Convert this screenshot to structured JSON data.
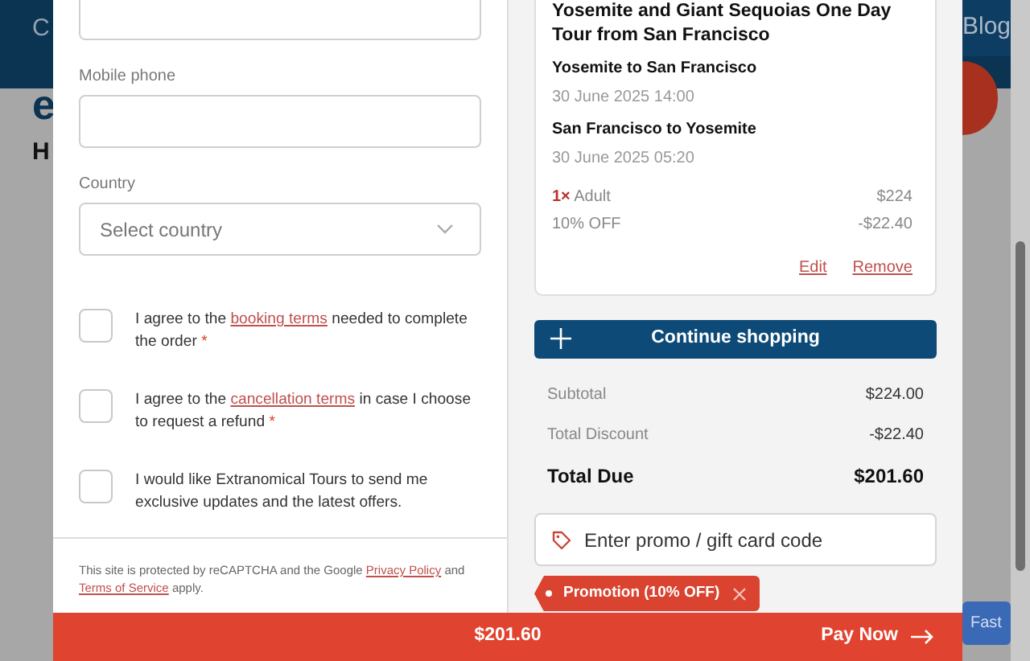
{
  "background": {
    "nav_left": "C",
    "nav_right": "Blog",
    "logo_letter": "e",
    "heading_letter": "H",
    "fast_button": "Fast"
  },
  "form": {
    "fields": [
      {
        "kind": "input"
      },
      {
        "kind": "input",
        "label": "Mobile phone"
      },
      {
        "kind": "select",
        "label": "Country",
        "placeholder": "Select country"
      }
    ],
    "consents": [
      {
        "before": "I agree to the ",
        "link": "booking terms",
        "after": " needed to complete the order",
        "mark": "*",
        "checked": false
      },
      {
        "before": "I agree to the ",
        "link": "cancellation terms",
        "after": " in case I choose to request a refund",
        "mark": "*",
        "checked": false
      },
      {
        "before": "I would like Extranomical Tours to send me exclusive updates and the latest offers.",
        "checked": false
      }
    ],
    "recaptcha": [
      {
        "kind": "text",
        "text": "This site is protected by reCAPTCHA and the Google "
      },
      {
        "kind": "link",
        "text": "Privacy Policy"
      },
      {
        "kind": "text",
        "text": " and "
      },
      {
        "kind": "link",
        "text": "Terms of Service"
      },
      {
        "kind": "text",
        "text": " apply."
      }
    ]
  },
  "cart": {
    "title": "Yosemite and Giant Sequoias One Day Tour from San Francisco",
    "legs": [
      {
        "route": "Yosemite to San Francisco",
        "date": "30 June 2025 14:00"
      },
      {
        "route": "San Francisco to Yosemite",
        "date": "30 June 2025 05:20"
      }
    ],
    "lines": [
      {
        "qty": "1×",
        "label": "Adult",
        "amount": "$224"
      },
      {
        "label": "10% OFF",
        "amount": "-$22.40"
      }
    ],
    "actions": [
      "Edit",
      "Remove"
    ]
  },
  "continue_button": "Continue shopping",
  "totals": [
    {
      "label": "Subtotal",
      "value": "$224.00",
      "kind": "plain"
    },
    {
      "label": "Total Discount",
      "value": "-$22.40",
      "kind": "plain"
    },
    {
      "label": "Total Due",
      "value": "$201.60",
      "kind": "total"
    }
  ],
  "promo": {
    "placeholder": "Enter promo / gift card code",
    "applied": "Promotion (10% OFF)"
  },
  "pay_bar": {
    "amount": "$201.60",
    "button": "Pay Now"
  }
}
